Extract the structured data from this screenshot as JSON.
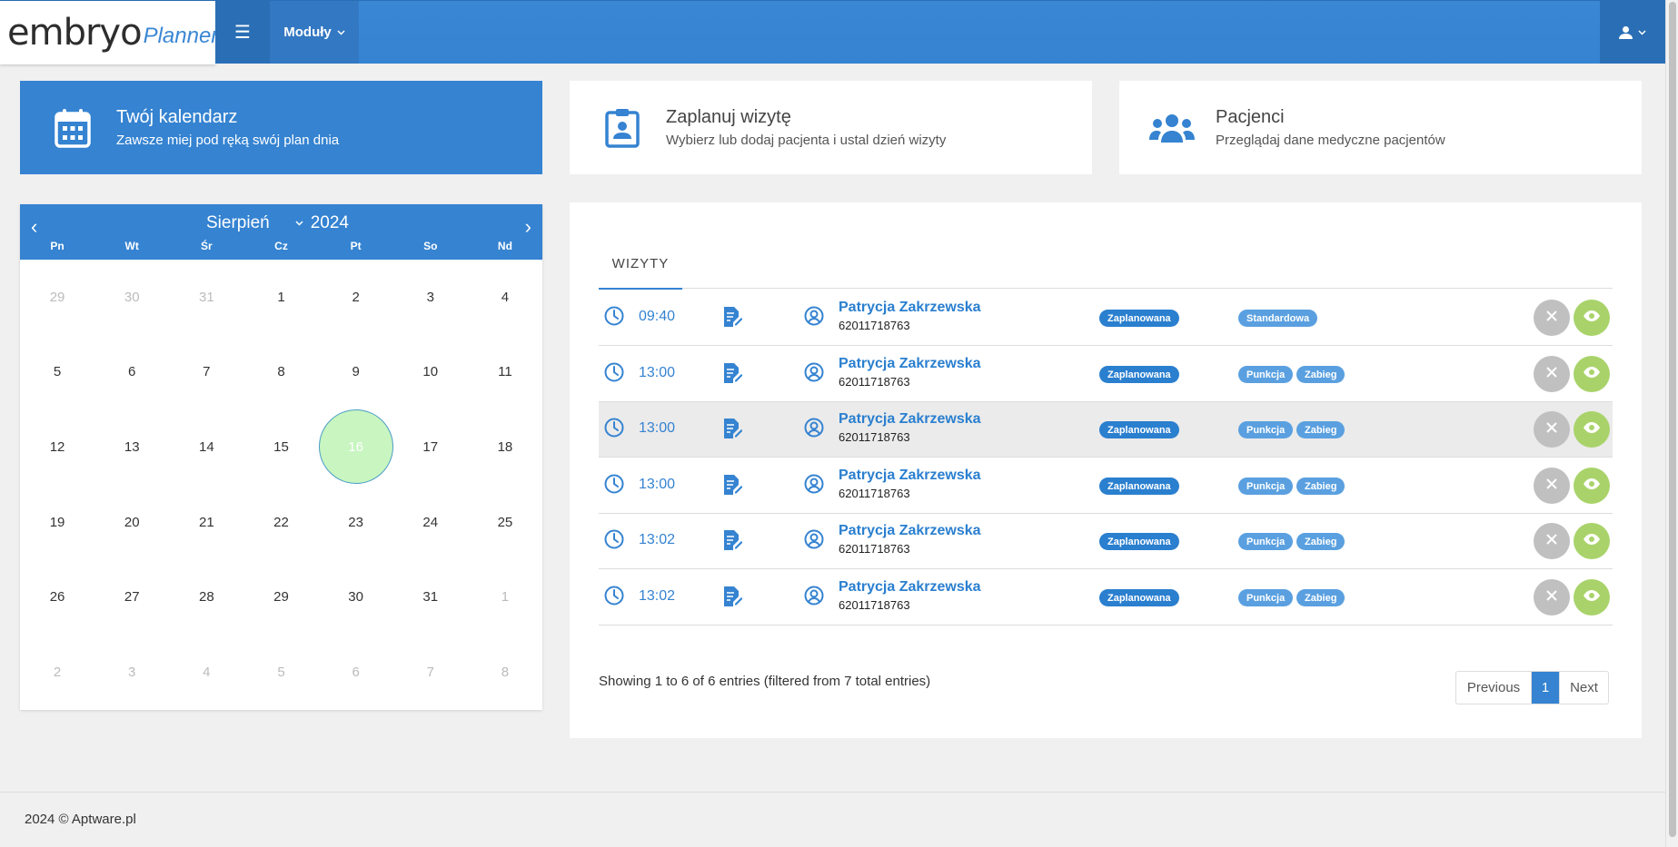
{
  "brand": {
    "name": "embryo",
    "suffix": "Planner"
  },
  "nav": {
    "modules_label": "Moduły"
  },
  "cards": {
    "calendar": {
      "title": "Twój kalendarz",
      "subtitle": "Zawsze miej pod ręką swój plan dnia"
    },
    "plan": {
      "title": "Zaplanuj wizytę",
      "subtitle": "Wybierz lub dodaj pacjenta i ustal dzień wizyty"
    },
    "patients": {
      "title": "Pacjenci",
      "subtitle": "Przeglądaj dane medyczne pacjentów"
    }
  },
  "calendar": {
    "month": "Sierpień",
    "year": "2024",
    "dows": [
      "Pn",
      "Wt",
      "Śr",
      "Cz",
      "Pt",
      "So",
      "Nd"
    ],
    "days": [
      {
        "d": "29",
        "m": true
      },
      {
        "d": "30",
        "m": true
      },
      {
        "d": "31",
        "m": true
      },
      {
        "d": "1"
      },
      {
        "d": "2"
      },
      {
        "d": "3"
      },
      {
        "d": "4"
      },
      {
        "d": "5"
      },
      {
        "d": "6"
      },
      {
        "d": "7"
      },
      {
        "d": "8"
      },
      {
        "d": "9"
      },
      {
        "d": "10"
      },
      {
        "d": "11"
      },
      {
        "d": "12"
      },
      {
        "d": "13"
      },
      {
        "d": "14"
      },
      {
        "d": "15"
      },
      {
        "d": "16",
        "today": true
      },
      {
        "d": "17"
      },
      {
        "d": "18"
      },
      {
        "d": "19"
      },
      {
        "d": "20"
      },
      {
        "d": "21"
      },
      {
        "d": "22"
      },
      {
        "d": "23"
      },
      {
        "d": "24"
      },
      {
        "d": "25"
      },
      {
        "d": "26"
      },
      {
        "d": "27"
      },
      {
        "d": "28"
      },
      {
        "d": "29"
      },
      {
        "d": "30"
      },
      {
        "d": "31"
      },
      {
        "d": "1",
        "m": true
      },
      {
        "d": "2",
        "m": true
      },
      {
        "d": "3",
        "m": true
      },
      {
        "d": "4",
        "m": true
      },
      {
        "d": "5",
        "m": true
      },
      {
        "d": "6",
        "m": true
      },
      {
        "d": "7",
        "m": true
      },
      {
        "d": "8",
        "m": true
      }
    ]
  },
  "visits": {
    "tab": "WIZYTY",
    "rows": [
      {
        "time": "09:40",
        "name": "Patrycja Zakrzewska",
        "pesel": "62011718763",
        "status": "Zaplanowana",
        "types": [
          "Standardowa"
        ]
      },
      {
        "time": "13:00",
        "name": "Patrycja Zakrzewska",
        "pesel": "62011718763",
        "status": "Zaplanowana",
        "types": [
          "Punkcja",
          "Zabieg"
        ]
      },
      {
        "time": "13:00",
        "name": "Patrycja Zakrzewska",
        "pesel": "62011718763",
        "status": "Zaplanowana",
        "types": [
          "Punkcja",
          "Zabieg"
        ],
        "highlight": true
      },
      {
        "time": "13:00",
        "name": "Patrycja Zakrzewska",
        "pesel": "62011718763",
        "status": "Zaplanowana",
        "types": [
          "Punkcja",
          "Zabieg"
        ]
      },
      {
        "time": "13:02",
        "name": "Patrycja Zakrzewska",
        "pesel": "62011718763",
        "status": "Zaplanowana",
        "types": [
          "Punkcja",
          "Zabieg"
        ]
      },
      {
        "time": "13:02",
        "name": "Patrycja Zakrzewska",
        "pesel": "62011718763",
        "status": "Zaplanowana",
        "types": [
          "Punkcja",
          "Zabieg"
        ]
      }
    ],
    "info": "Showing 1 to 6 of 6 entries (filtered from 7 total entries)",
    "pager": {
      "prev": "Previous",
      "page": "1",
      "next": "Next"
    }
  },
  "footer": {
    "text": "2024 © Aptware.pl"
  },
  "colors": {
    "primary": "#3583d1",
    "today": "#c8f5c0",
    "view_button": "#a9d36a",
    "cancel_button": "#c0c0c0"
  }
}
